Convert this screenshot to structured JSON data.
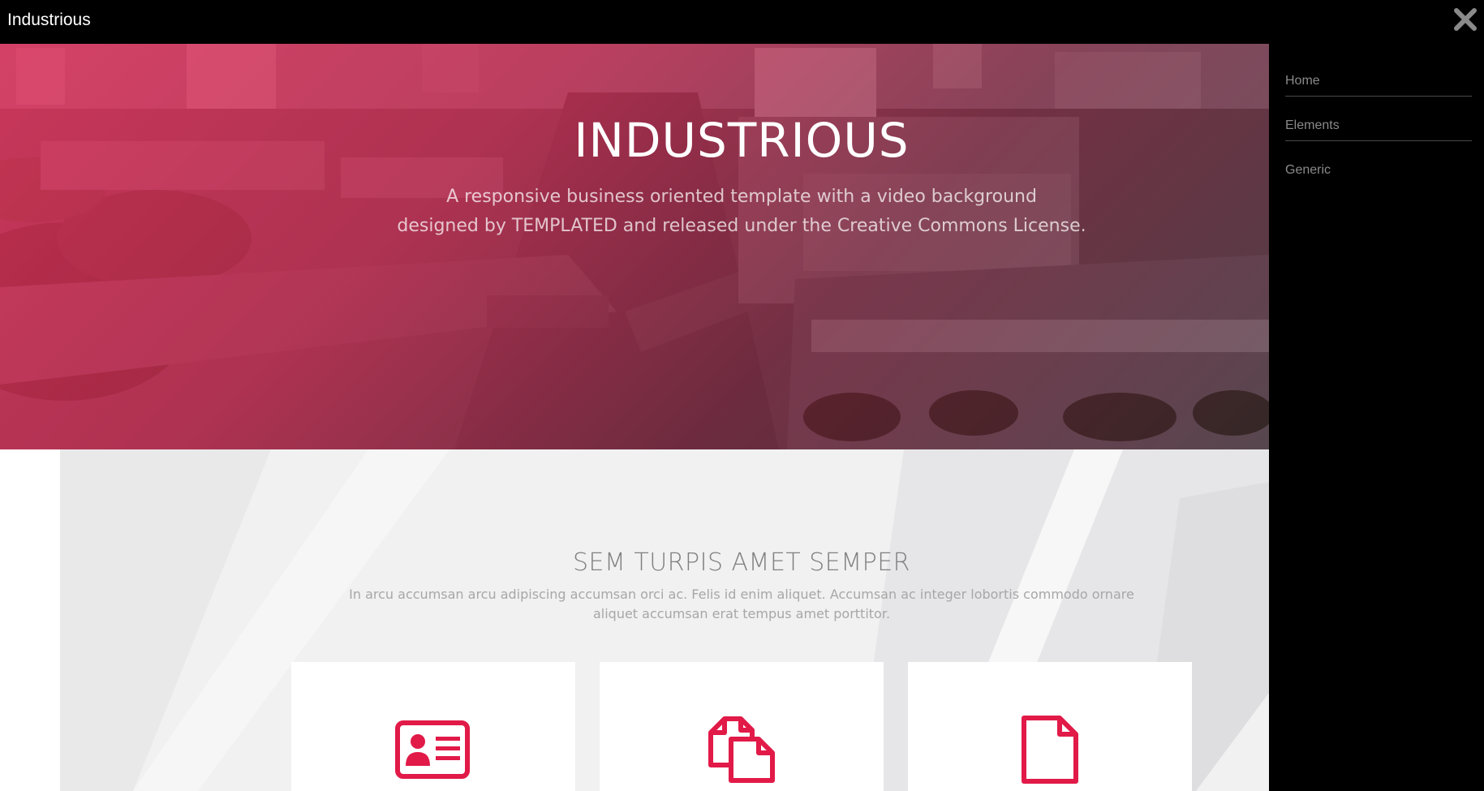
{
  "header": {
    "logo": "Industrious"
  },
  "nav": {
    "items": [
      {
        "label": "Home"
      },
      {
        "label": "Elements"
      },
      {
        "label": "Generic"
      }
    ]
  },
  "banner": {
    "title": "INDUSTRIOUS",
    "subtitle_line1": "A responsive business oriented template with a video background",
    "subtitle_line2": "designed by TEMPLATED and released under the Creative Commons License."
  },
  "section": {
    "title": "SEM TURPIS AMET SEMPER",
    "paragraph_line1": "In arcu accumsan arcu adipiscing accumsan orci ac. Felis id enim aliquet. Accumsan ac integer lobortis commodo ornare",
    "paragraph_line2": "aliquet accumsan erat tempus amet porttitor."
  },
  "cards": [
    {
      "icon": "id-card-icon"
    },
    {
      "icon": "copy-files-icon"
    },
    {
      "icon": "file-icon"
    }
  ],
  "colors": {
    "accent": "#e11a48",
    "header_bg": "#000000",
    "nav_text": "#8a8a8a",
    "section_bg": "#f1f1f2"
  }
}
